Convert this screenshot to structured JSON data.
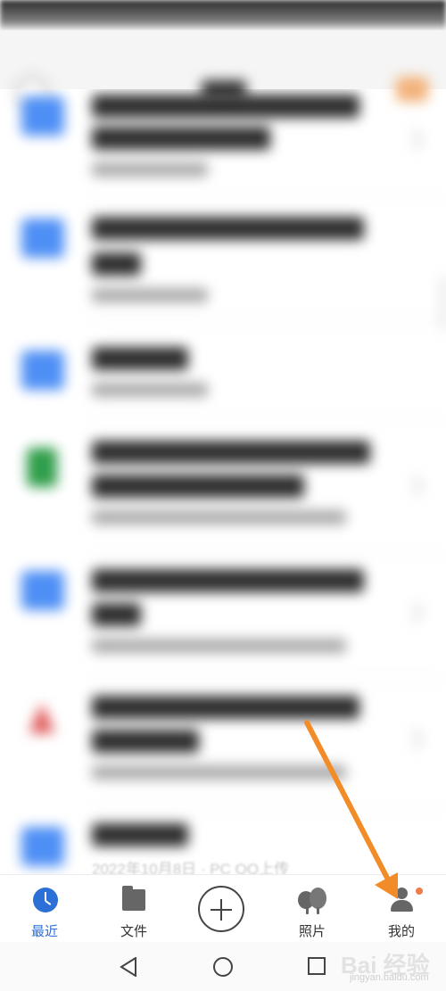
{
  "bottom_nav": {
    "items": [
      {
        "label": "最近",
        "icon": "clock-icon",
        "active": true
      },
      {
        "label": "文件",
        "icon": "folder-icon",
        "active": false
      },
      {
        "label": "",
        "icon": "add-icon",
        "active": false
      },
      {
        "label": "照片",
        "icon": "photo-icon",
        "active": false
      },
      {
        "label": "我的",
        "icon": "person-icon",
        "active": false
      }
    ]
  },
  "file_list": {
    "visible_caption": "2022年10月8日 · PC QQ上传"
  },
  "system_nav": {
    "icons": [
      "back-icon",
      "home-icon",
      "recents-icon"
    ]
  },
  "watermark": {
    "logo": "Bai 经验",
    "sub": "jingyan.baidu.com"
  },
  "colors": {
    "accent": "#2c6fd6",
    "annotation_arrow": "#f28c28",
    "badge": "#f07c4a",
    "folder": "#4e8ff5"
  }
}
